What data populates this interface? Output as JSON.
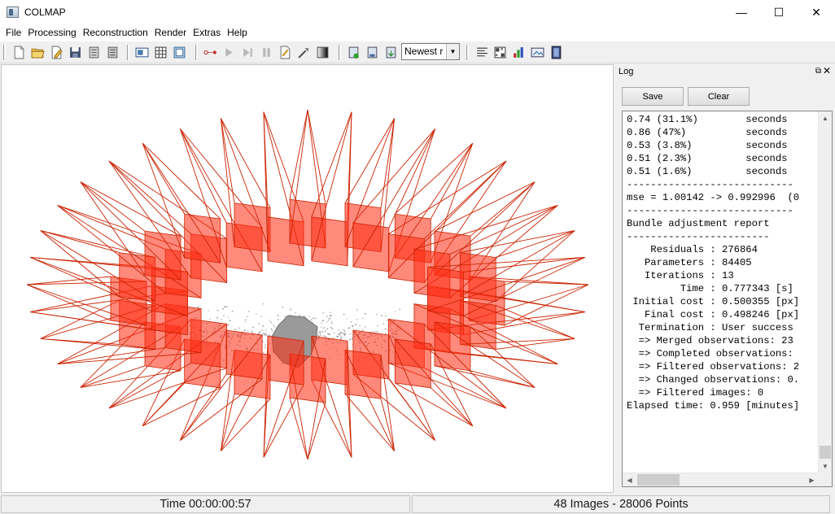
{
  "window": {
    "title": "COLMAP",
    "minimize_glyph": "—",
    "maximize_glyph": "☐",
    "close_glyph": "✕"
  },
  "menu": [
    "File",
    "Processing",
    "Reconstruction",
    "Render",
    "Extras",
    "Help"
  ],
  "toolbar": {
    "render_mode_value": "Newest r",
    "icons": [
      "new-project-icon",
      "open-project-icon",
      "edit-project-icon",
      "save-project-icon",
      "import-icon",
      "export-icon",
      "feature-extraction-icon",
      "feature-matching-icon",
      "database-management-icon",
      "start-reconstruction-icon",
      "step-reconstruction-icon",
      "pause-reconstruction-icon",
      "reset-reconstruction-icon",
      "bundle-adjustment-icon",
      "dense-reconstruction-icon",
      "render-toggle-icon",
      "render-options-icon",
      "reconstruction-stats-icon",
      "match-matrix-icon",
      "show-log-icon",
      "undistort-icon",
      "grab-image-icon",
      "grab-movie-icon",
      "reset-view-icon"
    ]
  },
  "log": {
    "title": "Log",
    "save_label": "Save",
    "clear_label": "Clear",
    "lines": [
      "0.74 (31.1%)        seconds",
      "0.86 (47%)          seconds",
      "0.53 (3.8%)         seconds",
      "0.51 (2.3%)         seconds",
      "0.51 (1.6%)         seconds",
      "----------------------------",
      "mse = 1.00142 -> 0.992996  (0",
      "----------------------------",
      "",
      "Bundle adjustment report",
      "------------------------",
      "    Residuals : 276864",
      "   Parameters : 84405",
      "   Iterations : 13",
      "         Time : 0.777343 [s]",
      " Initial cost : 0.500355 [px]",
      "   Final cost : 0.498246 [px]",
      "  Termination : User success",
      "",
      "  => Merged observations: 23",
      "  => Completed observations:",
      "  => Filtered observations: 2",
      "  => Changed observations: 0.",
      "  => Filtered images: 0",
      "",
      "Elapsed time: 0.959 [minutes]"
    ]
  },
  "status": {
    "time": "Time 00:00:00:57",
    "summary": "48 Images - 28006 Points"
  },
  "colors": {
    "camera_frustum": "#cc2200",
    "camera_plane": "#ff2a10",
    "point_cloud": "#8a8a8a"
  }
}
